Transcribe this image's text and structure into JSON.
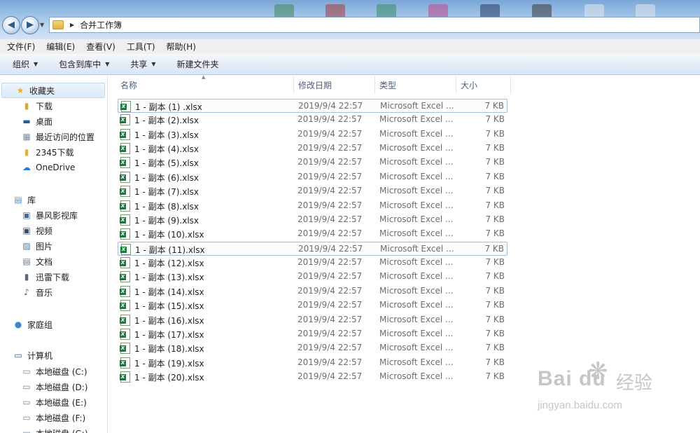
{
  "window": {
    "breadcrumb": "合并工作簿"
  },
  "menu": [
    "文件(F)",
    "编辑(E)",
    "查看(V)",
    "工具(T)",
    "帮助(H)"
  ],
  "toolbar": {
    "organize": "组织",
    "include_library": "包含到库中",
    "share": "共享",
    "new_folder": "新建文件夹"
  },
  "nav": {
    "favorites": "收藏夹",
    "fav_items": [
      "下载",
      "桌面",
      "最近访问的位置",
      "2345下载",
      "OneDrive"
    ],
    "libraries": "库",
    "lib_items": [
      "暴风影视库",
      "视频",
      "图片",
      "文档",
      "迅雷下载",
      "音乐"
    ],
    "homegroup": "家庭组",
    "computer": "计算机",
    "drives": [
      "本地磁盘 (C:)",
      "本地磁盘 (D:)",
      "本地磁盘 (E:)",
      "本地磁盘 (F:)",
      "本地磁盘 (G:)"
    ]
  },
  "columns": {
    "name": "名称",
    "date": "修改日期",
    "type": "类型",
    "size": "大小"
  },
  "files": [
    {
      "name": "1 - 副本 (1) .xlsx",
      "date": "2019/9/4 22:57",
      "type": "Microsoft Excel ...",
      "size": "7 KB"
    },
    {
      "name": "1 - 副本 (2).xlsx",
      "date": "2019/9/4 22:57",
      "type": "Microsoft Excel ...",
      "size": "7 KB"
    },
    {
      "name": "1 - 副本 (3).xlsx",
      "date": "2019/9/4 22:57",
      "type": "Microsoft Excel ...",
      "size": "7 KB"
    },
    {
      "name": "1 - 副本 (4).xlsx",
      "date": "2019/9/4 22:57",
      "type": "Microsoft Excel ...",
      "size": "7 KB"
    },
    {
      "name": "1 - 副本 (5).xlsx",
      "date": "2019/9/4 22:57",
      "type": "Microsoft Excel ...",
      "size": "7 KB"
    },
    {
      "name": "1 - 副本 (6).xlsx",
      "date": "2019/9/4 22:57",
      "type": "Microsoft Excel ...",
      "size": "7 KB"
    },
    {
      "name": "1 - 副本 (7).xlsx",
      "date": "2019/9/4 22:57",
      "type": "Microsoft Excel ...",
      "size": "7 KB"
    },
    {
      "name": "1 - 副本 (8).xlsx",
      "date": "2019/9/4 22:57",
      "type": "Microsoft Excel ...",
      "size": "7 KB"
    },
    {
      "name": "1 - 副本 (9).xlsx",
      "date": "2019/9/4 22:57",
      "type": "Microsoft Excel ...",
      "size": "7 KB"
    },
    {
      "name": "1 - 副本 (10).xlsx",
      "date": "2019/9/4 22:57",
      "type": "Microsoft Excel ...",
      "size": "7 KB"
    },
    {
      "name": "1 - 副本 (11).xlsx",
      "date": "2019/9/4 22:57",
      "type": "Microsoft Excel ...",
      "size": "7 KB"
    },
    {
      "name": "1 - 副本 (12).xlsx",
      "date": "2019/9/4 22:57",
      "type": "Microsoft Excel ...",
      "size": "7 KB"
    },
    {
      "name": "1 - 副本 (13).xlsx",
      "date": "2019/9/4 22:57",
      "type": "Microsoft Excel ...",
      "size": "7 KB"
    },
    {
      "name": "1 - 副本 (14).xlsx",
      "date": "2019/9/4 22:57",
      "type": "Microsoft Excel ...",
      "size": "7 KB"
    },
    {
      "name": "1 - 副本 (15).xlsx",
      "date": "2019/9/4 22:57",
      "type": "Microsoft Excel ...",
      "size": "7 KB"
    },
    {
      "name": "1 - 副本 (16).xlsx",
      "date": "2019/9/4 22:57",
      "type": "Microsoft Excel ...",
      "size": "7 KB"
    },
    {
      "name": "1 - 副本 (17).xlsx",
      "date": "2019/9/4 22:57",
      "type": "Microsoft Excel ...",
      "size": "7 KB"
    },
    {
      "name": "1 - 副本 (18).xlsx",
      "date": "2019/9/4 22:57",
      "type": "Microsoft Excel ...",
      "size": "7 KB"
    },
    {
      "name": "1 - 副本 (19).xlsx",
      "date": "2019/9/4 22:57",
      "type": "Microsoft Excel ...",
      "size": "7 KB"
    },
    {
      "name": "1 - 副本 (20).xlsx",
      "date": "2019/9/4 22:57",
      "type": "Microsoft Excel ...",
      "size": "7 KB"
    }
  ],
  "watermark": {
    "logo": "Bai du",
    "brand_cn": "经验",
    "url": "jingyan.baidu.com"
  }
}
